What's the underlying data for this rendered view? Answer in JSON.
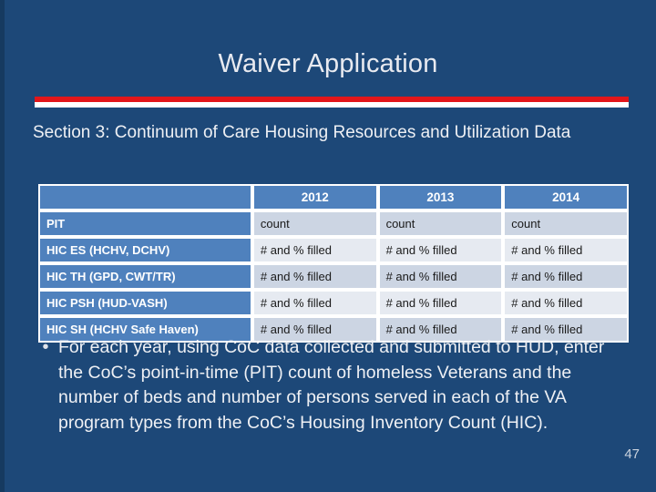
{
  "slide": {
    "title": "Waiver Application",
    "section_heading": "Section 3: Continuum of Care Housing Resources and Utilization Data",
    "page_number": "47",
    "accent_red": "#e2161a",
    "accent_white": "#ffffff",
    "background": "#1d4878",
    "table_header_blue": "#4f81bd"
  },
  "table": {
    "headers": [
      "",
      "2012",
      "2013",
      "2014"
    ],
    "rows": [
      {
        "label": "PIT",
        "values": [
          "count",
          "count",
          "count"
        ]
      },
      {
        "label": "HIC ES (HCHV, DCHV)",
        "values": [
          "# and % filled",
          "# and % filled",
          "# and % filled"
        ]
      },
      {
        "label": "HIC TH (GPD, CWT/TR)",
        "values": [
          "# and % filled",
          "# and % filled",
          "# and % filled"
        ]
      },
      {
        "label": "HIC PSH (HUD-VASH)",
        "values": [
          "# and % filled",
          "# and % filled",
          "# and % filled"
        ]
      },
      {
        "label": "HIC SH (HCHV Safe Haven)",
        "values": [
          "# and % filled",
          "# and % filled",
          "# and % filled"
        ]
      }
    ]
  },
  "bullets": [
    {
      "marker": "•",
      "text": "For each year, using CoC data collected and submitted to HUD, enter the CoC’s point-in-time (PIT) count of homeless Veterans and the number of beds and number of persons served in each of the VA program types from the CoC’s Housing Inventory Count (HIC)."
    }
  ]
}
